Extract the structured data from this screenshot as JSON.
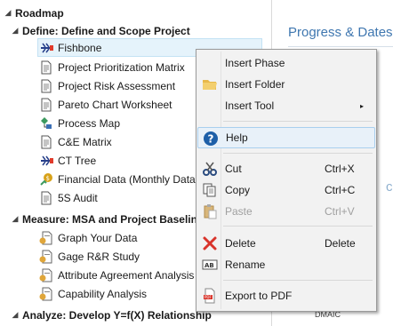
{
  "tree": {
    "root": "Roadmap",
    "define_phase": "Define:  Define and Scope Project",
    "define_items": [
      {
        "label": "Fishbone",
        "icon": "fishbone-icon"
      },
      {
        "label": "Project Prioritization Matrix",
        "icon": "document-icon"
      },
      {
        "label": "Project Risk Assessment",
        "icon": "document-icon"
      },
      {
        "label": "Pareto Chart Worksheet",
        "icon": "document-icon"
      },
      {
        "label": "Process Map",
        "icon": "process-map-icon"
      },
      {
        "label": "C&E Matrix",
        "icon": "document-icon"
      },
      {
        "label": "CT Tree",
        "icon": "tree-icon"
      },
      {
        "label": "Financial Data (Monthly Data)",
        "icon": "financial-icon"
      },
      {
        "label": "5S Audit",
        "icon": "document-icon"
      }
    ],
    "measure_phase": "Measure:  MSA and Project Baseline",
    "measure_items": [
      {
        "label": "Graph Your Data",
        "icon": "data-document-icon"
      },
      {
        "label": "Gage R&R Study",
        "icon": "data-document-icon"
      },
      {
        "label": "Attribute Agreement Analysis",
        "icon": "data-document-icon"
      },
      {
        "label": "Capability Analysis",
        "icon": "data-document-icon"
      }
    ],
    "analyze_phase": "Analyze:  Develop Y=f(X) Relationship"
  },
  "right_pane": {
    "heading": "Progress & Dates",
    "partial_text": "cati",
    "footer": "DMAIC"
  },
  "context_menu": {
    "items": [
      {
        "label": "Insert Phase",
        "shortcut": "",
        "icon": "",
        "enabled": true
      },
      {
        "label": "Insert Folder",
        "shortcut": "",
        "icon": "folder-icon",
        "enabled": true
      },
      {
        "label": "Insert Tool",
        "shortcut": "",
        "icon": "",
        "enabled": true,
        "submenu": "▸"
      },
      {
        "label": "Help",
        "shortcut": "",
        "icon": "help-icon",
        "enabled": true
      },
      {
        "label": "Cut",
        "shortcut": "Ctrl+X",
        "icon": "scissors-icon",
        "enabled": true
      },
      {
        "label": "Copy",
        "shortcut": "Ctrl+C",
        "icon": "copy-icon",
        "enabled": true
      },
      {
        "label": "Paste",
        "shortcut": "Ctrl+V",
        "icon": "paste-icon",
        "enabled": false
      },
      {
        "label": "Delete",
        "shortcut": "Delete",
        "icon": "delete-icon",
        "enabled": true
      },
      {
        "label": "Rename",
        "shortcut": "",
        "icon": "rename-icon",
        "enabled": true
      },
      {
        "label": "Export to PDF",
        "shortcut": "",
        "icon": "pdf-icon",
        "enabled": true
      }
    ]
  },
  "colors": {
    "accent": "#3f77b0",
    "selection": "#e5f3fb",
    "menu_bg": "#f2f2f2",
    "delete_red": "#d9342b"
  }
}
